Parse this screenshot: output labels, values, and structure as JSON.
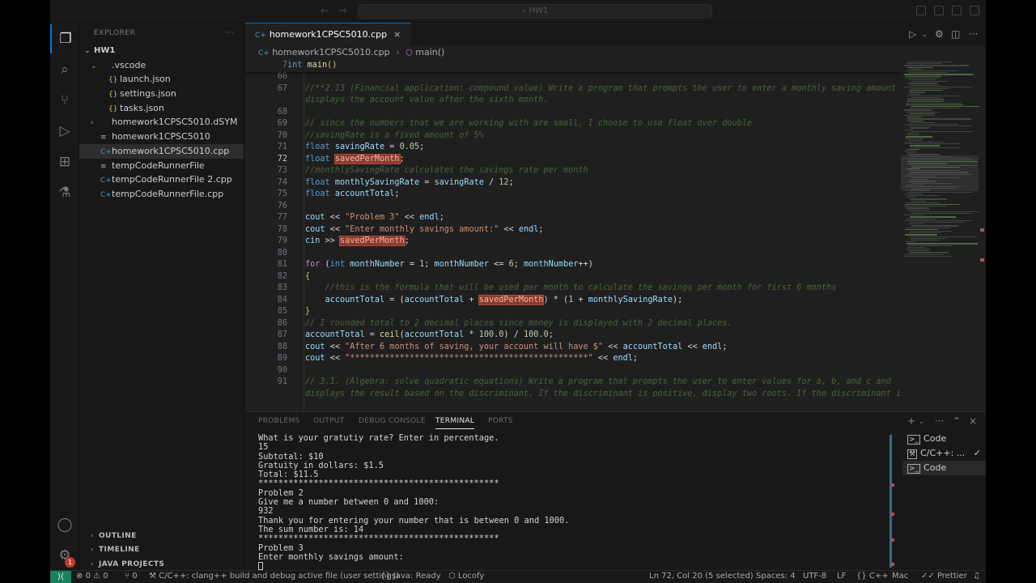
{
  "window": {
    "title": "HW1"
  },
  "activity": {
    "items": [
      "explorer-icon",
      "search-icon",
      "source-control-icon",
      "run-debug-icon",
      "extensions-icon",
      "testing-icon"
    ],
    "bottom": [
      "account-icon",
      "manage-gear-icon"
    ],
    "badge": "1"
  },
  "sidebar": {
    "title": "EXPLORER",
    "more": "···",
    "root": "HW1",
    "tree": [
      {
        "label": ".vscode",
        "kind": "folder-open",
        "depth": 1
      },
      {
        "label": "launch.json",
        "kind": "json",
        "depth": 2
      },
      {
        "label": "settings.json",
        "kind": "json",
        "depth": 2
      },
      {
        "label": "tasks.json",
        "kind": "json",
        "depth": 2
      },
      {
        "label": "homework1CPSC5010.dSYM",
        "kind": "folder",
        "depth": 1
      },
      {
        "label": "homework1CPSC5010",
        "kind": "file",
        "depth": 1
      },
      {
        "label": "homework1CPSC5010.cpp",
        "kind": "cpp",
        "depth": 1,
        "selected": true
      },
      {
        "label": "tempCodeRunnerFile",
        "kind": "file",
        "depth": 1
      },
      {
        "label": "tempCodeRunnerFile 2.cpp",
        "kind": "cpp",
        "depth": 1
      },
      {
        "label": "tempCodeRunnerFile.cpp",
        "kind": "cpp",
        "depth": 1
      }
    ],
    "sections": [
      "OUTLINE",
      "TIMELINE",
      "JAVA PROJECTS"
    ]
  },
  "editor": {
    "tab": "homework1CPSC5010.cpp",
    "breadcrumb_file": "homework1CPSC5010.cpp",
    "breadcrumb_symbol": "main()",
    "sticky_line_number": "7",
    "current_line": "72"
  },
  "panel": {
    "tabs": [
      "PROBLEMS",
      "OUTPUT",
      "DEBUG CONSOLE",
      "TERMINAL",
      "PORTS"
    ],
    "active_tab": "TERMINAL",
    "terminal_lines": [
      "What is your gratutiy rate? Enter in percentage.",
      "15",
      "Subtotal: $10",
      "Gratuity in dollars: $1.5",
      "Total: $11.5",
      "************************************************",
      "Problem 2",
      "Give me a number between 0 and 1000:",
      "932",
      "Thank you for entering your number that is between 0 and 1000.",
      "The sum number is: 14",
      "************************************************",
      "Problem 3",
      "Enter monthly savings amount:"
    ],
    "terminals": [
      "Code",
      "C/C++: ...",
      "Code"
    ]
  },
  "status": {
    "errors": "0",
    "warnings": "0",
    "ports": "0",
    "task": "C/C++: clang++ build and debug active file (user settings)",
    "java": "Java: Ready",
    "locofy": "Locofy",
    "position": "Ln 72, Col 20 (5 selected)",
    "spaces": "Spaces: 4",
    "encoding": "UTF-8",
    "eol": "LF",
    "language": "C++",
    "platform": "Mac",
    "prettier": "Prettier"
  },
  "colors": {
    "accent": "#0078d4",
    "remote": "#16825d",
    "highlight": "#8b3a2b"
  }
}
